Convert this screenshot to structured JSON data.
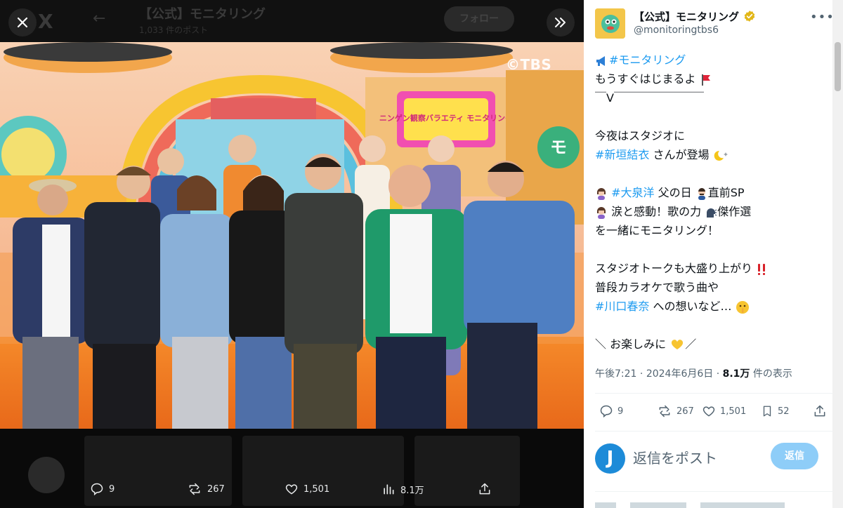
{
  "viewer": {
    "ghost_header": {
      "title": "【公式】モニタリング",
      "subtitle": "1,033 件のポスト",
      "follow_label": "フォロー"
    },
    "photo_watermark": "©TBS",
    "set_sign": "ニンゲン観察バラエティ モニタリング",
    "media_actions": {
      "replies": "9",
      "reposts": "267",
      "likes": "1,501",
      "views": "8.1万"
    }
  },
  "tweet": {
    "account": {
      "name": "【公式】モニタリング",
      "handle": "@monitoringtbs6",
      "verified": true
    },
    "body": {
      "line1_tag": "#モニタリング",
      "line2": "もうすぐはじまるよ",
      "line3": "￣V￣￣￣￣￣￣￣￣",
      "line5": "今夜はスタジオに",
      "line6_tag": "#新垣結衣",
      "line6_rest": " さんが登場",
      "line8_tag": "#大泉洋",
      "line8_mid": " 父の日",
      "line8_end": "直前SP",
      "line9": "涙と感動！歌の力",
      "line9_end": "傑作選",
      "line10": "を一緒にモニタリング！",
      "line12": "スタジオトークも大盛り上がり",
      "line13": "普段カラオケで歌う曲や",
      "line14_tag": "#川口春奈",
      "line14_rest": " への想いなど…",
      "line16_start": "＼ お楽しみに",
      "line16_end": "／"
    },
    "meta": {
      "time": "午後7:21",
      "separator": "·",
      "date": "2024年6月6日",
      "views_count": "8.1万",
      "views_label": " 件の表示"
    },
    "actions": {
      "replies": "9",
      "reposts": "267",
      "likes": "1,501",
      "bookmarks": "52"
    },
    "reply": {
      "avatar_letter": "J",
      "placeholder": "返信をポスト",
      "button_label": "返信"
    }
  },
  "colors": {
    "accent": "#1d9bf0",
    "reply_button": "#8ecdf8",
    "verified_gold": "#e2b719",
    "stage_orange": "#f27a1a"
  },
  "icons": [
    "close-icon",
    "x-logo-icon",
    "back-arrow-icon",
    "expand-icon",
    "reply-icon",
    "repost-icon",
    "like-icon",
    "views-icon",
    "share-icon",
    "bookmark-icon",
    "more-icon",
    "verified-badge-icon",
    "megaphone-emoji",
    "flag-emoji",
    "moon-sparkle-emoji",
    "woman-emoji",
    "man-emoji",
    "speaking-head-emoji",
    "double-exclamation-emoji",
    "shushing-face-emoji",
    "heart-hands-emoji"
  ]
}
